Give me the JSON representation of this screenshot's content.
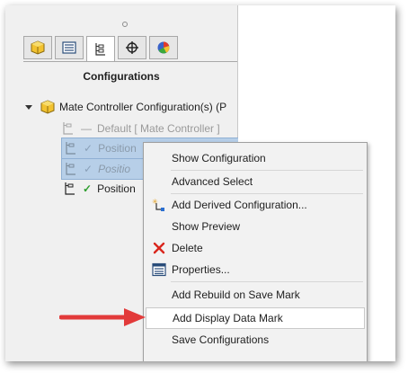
{
  "panel": {
    "title": "Configurations",
    "tabs": [
      {
        "name": "feature-manager-icon"
      },
      {
        "name": "property-manager-icon"
      },
      {
        "name": "configuration-manager-icon"
      },
      {
        "name": "dimxpert-icon"
      },
      {
        "name": "display-manager-icon"
      }
    ]
  },
  "tree": {
    "root_label": "Mate Controller Configuration(s)  (P",
    "items": [
      {
        "label": "Default [ Mate Controller ]"
      },
      {
        "label": "Position"
      },
      {
        "label": "Positio"
      },
      {
        "label": "Position"
      }
    ]
  },
  "context_menu": {
    "items": [
      {
        "label": "Show Configuration"
      },
      {
        "label": "Advanced Select"
      },
      {
        "label": "Add Derived Configuration..."
      },
      {
        "label": "Show Preview"
      },
      {
        "label": "Delete"
      },
      {
        "label": "Properties..."
      },
      {
        "label": "Add Rebuild on Save Mark"
      },
      {
        "label": "Add Display Data Mark"
      },
      {
        "label": "Save Configurations"
      }
    ]
  },
  "colors": {
    "selection": "#b7cfe8",
    "check": "#2e9e2e",
    "delete": "#d9261c",
    "arrow": "#e23a3a"
  }
}
